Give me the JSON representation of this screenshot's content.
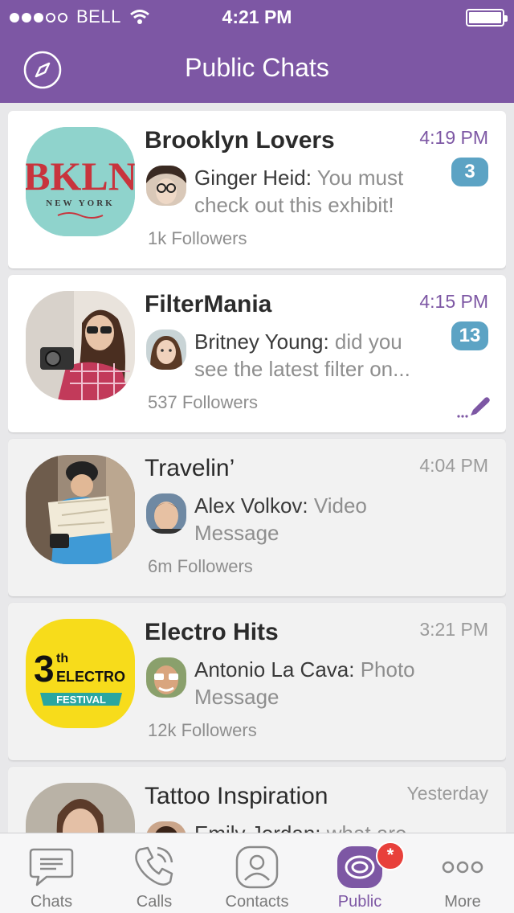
{
  "status_bar": {
    "carrier": "BELL",
    "time": "4:21 PM"
  },
  "nav": {
    "title": "Public Chats",
    "left_icon": "compass-icon"
  },
  "chats": [
    {
      "name": "Brooklyn Lovers",
      "time": "4:19 PM",
      "sender": "Ginger Heid:",
      "message": " You must check out this exhibit!",
      "followers": "1k Followers",
      "badge": "3",
      "unread": true,
      "avatar_text": "BKLN",
      "avatar_sub": "NEW YORK"
    },
    {
      "name": "FilterMania",
      "time": "4:15 PM",
      "sender": "Britney Young:",
      "message": " did you see the latest filter on...",
      "followers": "537 Followers",
      "badge": "13",
      "unread": true
    },
    {
      "name": "Travelin’",
      "time": "4:04 PM",
      "sender": "Alex Volkov:",
      "message": " Video Message",
      "followers": "6m Followers",
      "badge": "",
      "unread": false
    },
    {
      "name": "Electro Hits",
      "time": "3:21 PM",
      "sender": "Antonio La Cava:",
      "message": " Photo Message",
      "followers": "12k Followers",
      "badge": "",
      "unread": false,
      "avatar_text": "3",
      "avatar_sup": "th",
      "avatar_word": "ELECTRO",
      "avatar_band": "FESTIVAL"
    },
    {
      "name": "Tattoo Inspiration",
      "time": "Yesterday",
      "sender": "Emily Jordan:",
      "message": " what are",
      "followers": "",
      "badge": "",
      "unread": false
    }
  ],
  "tabs": [
    {
      "label": "Chats",
      "icon": "chat-bubble-icon"
    },
    {
      "label": "Calls",
      "icon": "phone-icon"
    },
    {
      "label": "Contacts",
      "icon": "contacts-icon"
    },
    {
      "label": "Public",
      "icon": "public-chat-icon",
      "badge": "*"
    },
    {
      "label": "More",
      "icon": "more-dots-icon"
    }
  ],
  "colors": {
    "accent": "#7d57a4",
    "badge": "#5ca3c4",
    "alert": "#e8403b"
  }
}
